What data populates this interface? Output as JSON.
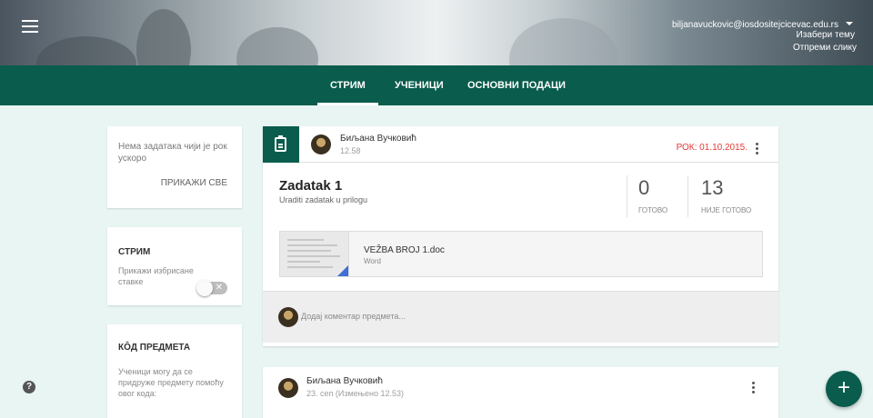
{
  "header": {
    "user_email": "biljanavuckovic@iosdositejcicevac.edu.rs",
    "choose_theme": "Изабери тему",
    "send_image": "Отпреми слику"
  },
  "tabs": [
    {
      "label": "СТРИМ",
      "active": true
    },
    {
      "label": "УЧЕНИЦИ",
      "active": false
    },
    {
      "label": "ОСНОВНИ ПОДАЦИ",
      "active": false
    }
  ],
  "upcoming": {
    "text": "Нема задатака чији је рок ускоро",
    "show_all": "ПРИКАЖИ СВЕ"
  },
  "stream_card": {
    "title": "СТРИМ",
    "show_deleted": "Прикажи избрисане ставке",
    "toggle_on": false
  },
  "class_code": {
    "title": "КÔД ПРЕДМЕТА",
    "description": "Ученици могу да се придруже предмету помоћу овог кода:"
  },
  "post1": {
    "author": "Биљана Вучковић",
    "time": "12.58",
    "due": "РОК: 01.10.2015.",
    "title": "Zadatak 1",
    "description": "Uraditi zadatak u prilogu",
    "done_count": "0",
    "done_label": "ГОТОВО",
    "not_done_count": "13",
    "not_done_label": "НИЈЕ ГОТОВО",
    "attachment": {
      "name": "VEŽBA BROJ 1.doc",
      "type": "Word"
    },
    "comment_placeholder": "Додај коментар предмета..."
  },
  "post2": {
    "author": "Биљана Вучковић",
    "time": "23. сеп (Измењено 12.53)"
  },
  "colors": {
    "primary": "#0a5c4c",
    "due": "#e53935",
    "background": "#e8f5f3"
  },
  "icons": [
    "menu-icon",
    "clipboard-icon",
    "more-vert-icon",
    "help-icon",
    "add-icon",
    "word-doc-icon",
    "close-icon"
  ]
}
